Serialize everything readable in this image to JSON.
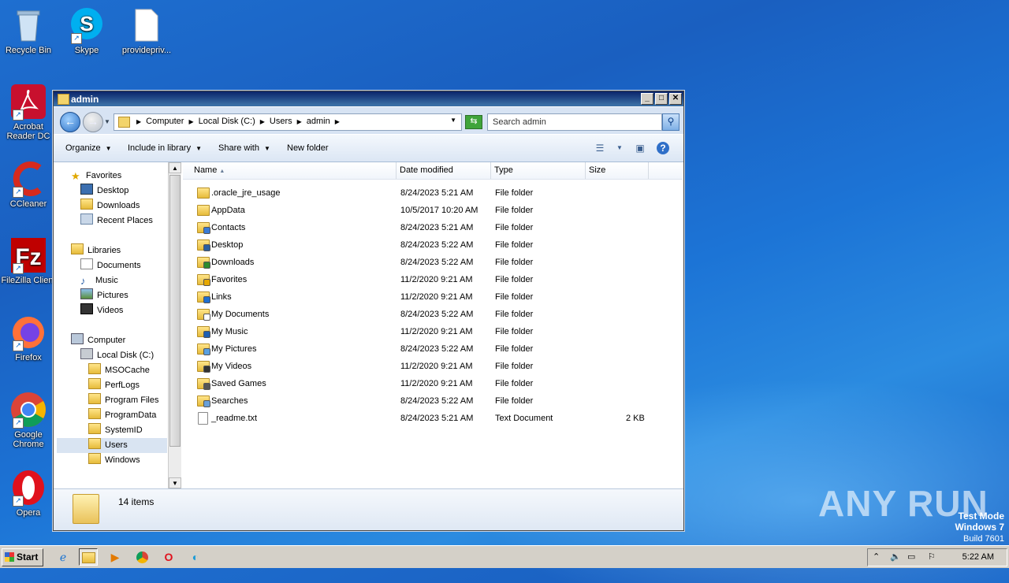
{
  "desktop": {
    "icons": [
      {
        "label": "Recycle Bin",
        "icon": "recycle-bin-icon"
      },
      {
        "label": "Skype",
        "icon": "skype-icon"
      },
      {
        "label": "providepriv...",
        "icon": "blank-file-icon"
      },
      {
        "label": "Acrobat Reader DC",
        "icon": "acrobat-icon"
      },
      {
        "label": "CCleaner",
        "icon": "ccleaner-icon"
      },
      {
        "label": "FileZilla Client",
        "icon": "filezilla-icon"
      },
      {
        "label": "Firefox",
        "icon": "firefox-icon"
      },
      {
        "label": "Google Chrome",
        "icon": "chrome-icon"
      },
      {
        "label": "Opera",
        "icon": "opera-icon"
      }
    ]
  },
  "window": {
    "title": "admin",
    "controls": {
      "minimize": "_",
      "maximize": "□",
      "close": "✕"
    },
    "address": {
      "crumbs": [
        "Computer",
        "Local Disk (C:)",
        "Users",
        "admin"
      ]
    },
    "search_placeholder": "Search admin",
    "toolbar": {
      "organize": "Organize",
      "include_in_library": "Include in library",
      "share_with": "Share with",
      "new_folder": "New folder"
    },
    "nav": {
      "favorites": {
        "label": "Favorites",
        "items": [
          "Desktop",
          "Downloads",
          "Recent Places"
        ]
      },
      "libraries": {
        "label": "Libraries",
        "items": [
          "Documents",
          "Music",
          "Pictures",
          "Videos"
        ]
      },
      "computer": {
        "label": "Computer",
        "drive": "Local Disk (C:)",
        "folders": [
          "MSOCache",
          "PerfLogs",
          "Program Files",
          "ProgramData",
          "SystemID",
          "Users",
          "Windows"
        ],
        "selected": "Users"
      }
    },
    "columns": {
      "name": "Name",
      "date": "Date modified",
      "type": "Type",
      "size": "Size"
    },
    "files": [
      {
        "name": ".oracle_jre_usage",
        "date": "8/24/2023 5:21 AM",
        "type": "File folder",
        "size": ""
      },
      {
        "name": "AppData",
        "date": "10/5/2017 10:20 AM",
        "type": "File folder",
        "size": ""
      },
      {
        "name": "Contacts",
        "date": "8/24/2023 5:21 AM",
        "type": "File folder",
        "size": ""
      },
      {
        "name": "Desktop",
        "date": "8/24/2023 5:22 AM",
        "type": "File folder",
        "size": ""
      },
      {
        "name": "Downloads",
        "date": "8/24/2023 5:22 AM",
        "type": "File folder",
        "size": ""
      },
      {
        "name": "Favorites",
        "date": "11/2/2020 9:21 AM",
        "type": "File folder",
        "size": ""
      },
      {
        "name": "Links",
        "date": "11/2/2020 9:21 AM",
        "type": "File folder",
        "size": ""
      },
      {
        "name": "My Documents",
        "date": "8/24/2023 5:22 AM",
        "type": "File folder",
        "size": ""
      },
      {
        "name": "My Music",
        "date": "11/2/2020 9:21 AM",
        "type": "File folder",
        "size": ""
      },
      {
        "name": "My Pictures",
        "date": "8/24/2023 5:22 AM",
        "type": "File folder",
        "size": ""
      },
      {
        "name": "My Videos",
        "date": "11/2/2020 9:21 AM",
        "type": "File folder",
        "size": ""
      },
      {
        "name": "Saved Games",
        "date": "11/2/2020 9:21 AM",
        "type": "File folder",
        "size": ""
      },
      {
        "name": "Searches",
        "date": "8/24/2023 5:22 AM",
        "type": "File folder",
        "size": ""
      },
      {
        "name": "_readme.txt",
        "date": "8/24/2023 5:21 AM",
        "type": "Text Document",
        "size": "2 KB"
      }
    ],
    "status": {
      "count": "14 items"
    }
  },
  "taskbar": {
    "start": "Start",
    "apps": [
      "ie-icon",
      "explorer-icon",
      "media-player-icon",
      "chrome-icon",
      "opera-icon",
      "edge-icon"
    ],
    "clock": "5:22 AM"
  },
  "watermark": {
    "line1": "Test Mode",
    "line2": "Windows 7",
    "line3": "Build 7601",
    "brand": "ANY RUN"
  }
}
